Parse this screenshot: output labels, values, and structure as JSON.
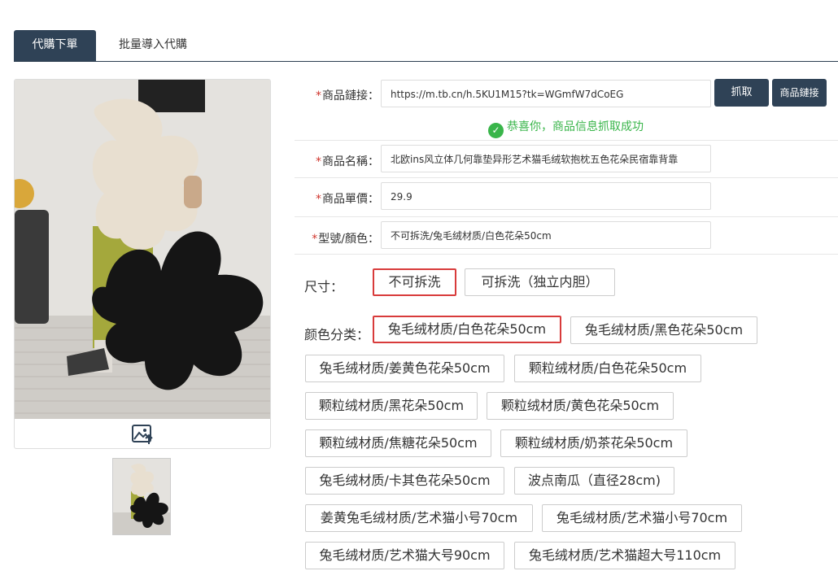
{
  "tabs": {
    "active": "代購下單",
    "inactive": "批量導入代購"
  },
  "form": {
    "required_mark": "*",
    "link_label": "商品鏈接：",
    "link_value": "https://m.tb.cn/h.5KU1M15?tk=WGmfW7dCoEG",
    "fetch_button": "抓取",
    "link_button": "商品鏈接",
    "success_message": "恭喜你，商品信息抓取成功",
    "name_label": "商品名稱：",
    "name_value": "北欧ins风立体几何靠垫异形艺术猫毛绒软抱枕五色花朵民宿靠背靠",
    "price_label": "商品單價：",
    "price_value": "29.9",
    "model_label": "型號/顏色：",
    "model_value": "不可拆洗/兔毛绒材质/白色花朵50cm"
  },
  "size": {
    "label": "尺寸：",
    "options": [
      "不可拆洗",
      "可拆洗（独立内胆）"
    ],
    "selected": "不可拆洗"
  },
  "color": {
    "label": "颜色分类：",
    "options": [
      "兔毛绒材质/白色花朵50cm",
      "兔毛绒材质/黑色花朵50cm",
      "兔毛绒材质/姜黄色花朵50cm",
      "颗粒绒材质/白色花朵50cm",
      "颗粒绒材质/黑花朵50cm",
      "颗粒绒材质/黄色花朵50cm",
      "颗粒绒材质/焦糖花朵50cm",
      "颗粒绒材质/奶茶花朵50cm",
      "兔毛绒材质/卡其色花朵50cm",
      "波点南瓜（直径28cm)",
      "姜黄兔毛绒材质/艺术猫小号70cm",
      "兔毛绒材质/艺术猫小号70cm",
      "兔毛绒材质/艺术猫大号90cm",
      "兔毛绒材质/艺术猫超大号110cm"
    ],
    "selected": "兔毛绒材质/白色花朵50cm"
  },
  "icons": {
    "upload": "image-upload-icon"
  },
  "colors": {
    "primary": "#2f4256",
    "success": "#39b54a",
    "selected_border": "#d83b3b",
    "required": "#d0342c"
  }
}
